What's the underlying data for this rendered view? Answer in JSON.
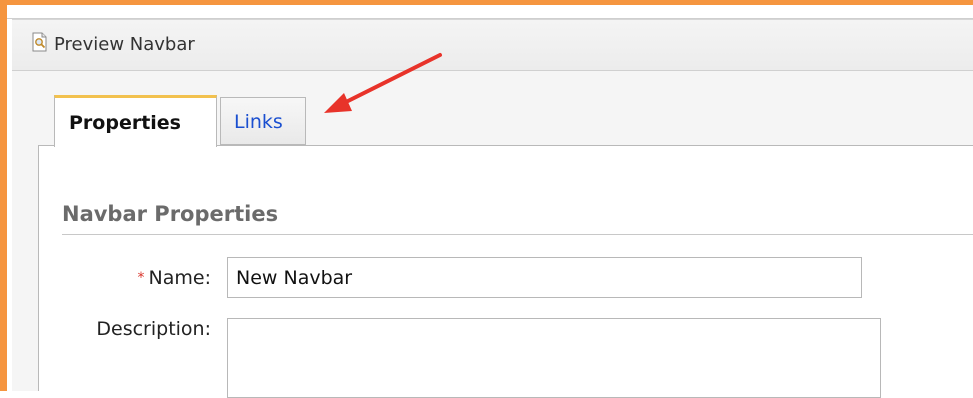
{
  "window": {
    "title": "Preview Navbar",
    "title_icon": "document-magnifier-icon"
  },
  "tabs": [
    {
      "label": "Properties",
      "active": true
    },
    {
      "label": "Links",
      "active": false
    }
  ],
  "section": {
    "title": "Navbar Properties"
  },
  "form": {
    "name_required_marker": "*",
    "name_label": "Name:",
    "name_value": "New Navbar",
    "description_label": "Description:",
    "description_value": ""
  },
  "annotation": {
    "icon": "red-arrow-icon",
    "color": "#e8332a"
  },
  "colors": {
    "highlight_frame": "#f5953f",
    "active_tab_accent": "#f2c14e",
    "link_tab_text": "#1a4fd0",
    "required_marker": "#d9352b"
  }
}
